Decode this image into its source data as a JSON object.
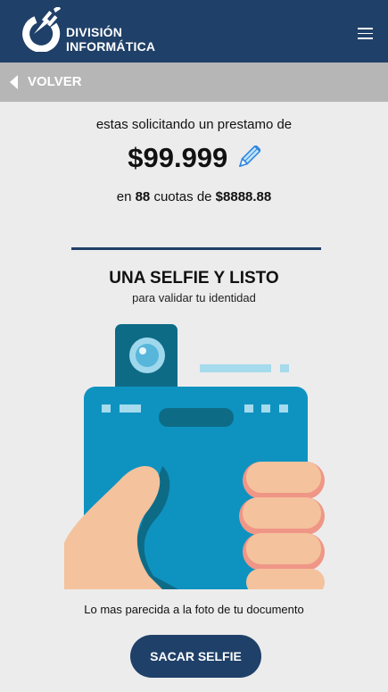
{
  "header": {
    "brand_line1": "DIVISIÓN",
    "brand_line2": "INFORMÁTICA",
    "logo_icon": "plug-power-logo",
    "menu_icon": "hamburger-menu-icon",
    "background_color": "#1f4068"
  },
  "back": {
    "label": "VOLVER",
    "icon": "chevron-left-icon"
  },
  "loan": {
    "intro": "estas solicitando un prestamo de",
    "amount": "$99.999",
    "edit_icon": "pencil-icon",
    "cuotas_prefix": "en",
    "cuotas_count": "88",
    "cuotas_mid": "cuotas de",
    "cuota_amount": "$8888.88"
  },
  "selfie": {
    "title": "UNA SELFIE Y LISTO",
    "subtitle": "para validar tu identidad",
    "illustration": "hand-holding-phone-selfie",
    "hint": "Lo mas parecida a la foto de tu documento",
    "button_label": "SACAR SELFIE"
  },
  "colors": {
    "accent": "#1f4068",
    "phone": "#0d93c2",
    "skin": "#f4c29c"
  }
}
